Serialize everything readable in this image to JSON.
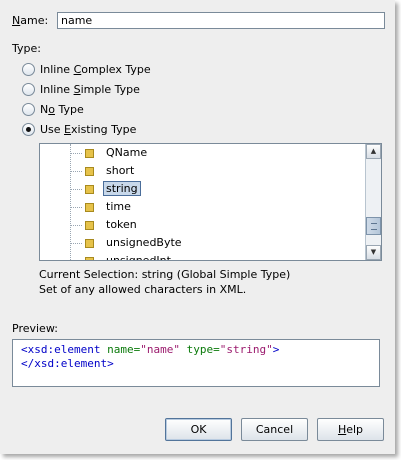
{
  "name_label_pre": "",
  "name_label_mnemonic": "N",
  "name_label_post": "ame:",
  "name_value": "name",
  "type_label": "Type:",
  "radios": [
    {
      "pre": "Inline ",
      "mn": "C",
      "post": "omplex Type",
      "selected": false
    },
    {
      "pre": "Inline ",
      "mn": "S",
      "post": "imple Type",
      "selected": false
    },
    {
      "pre": "N",
      "mn": "o",
      "post": " Type",
      "selected": false
    },
    {
      "pre": "Use ",
      "mn": "E",
      "post": "xisting Type",
      "selected": true
    }
  ],
  "tree_items": [
    "QName",
    "short",
    "string",
    "time",
    "token",
    "unsignedByte",
    "unsignedInt"
  ],
  "selected_item": "string",
  "current_selection": "Current Selection: string (Global Simple Type)",
  "description": "Set of any allowed characters in XML.",
  "preview_label": "Preview:",
  "preview": {
    "open_tag": "<xsd:element",
    "attr1": "name=",
    "val1": "\"name\"",
    "attr2": "type=",
    "val2": "\"string\"",
    "close_bracket": ">",
    "end_tag": "</xsd:element>"
  },
  "buttons": {
    "ok": "OK",
    "cancel": "Cancel",
    "help_mn": "H",
    "help_post": "elp"
  }
}
